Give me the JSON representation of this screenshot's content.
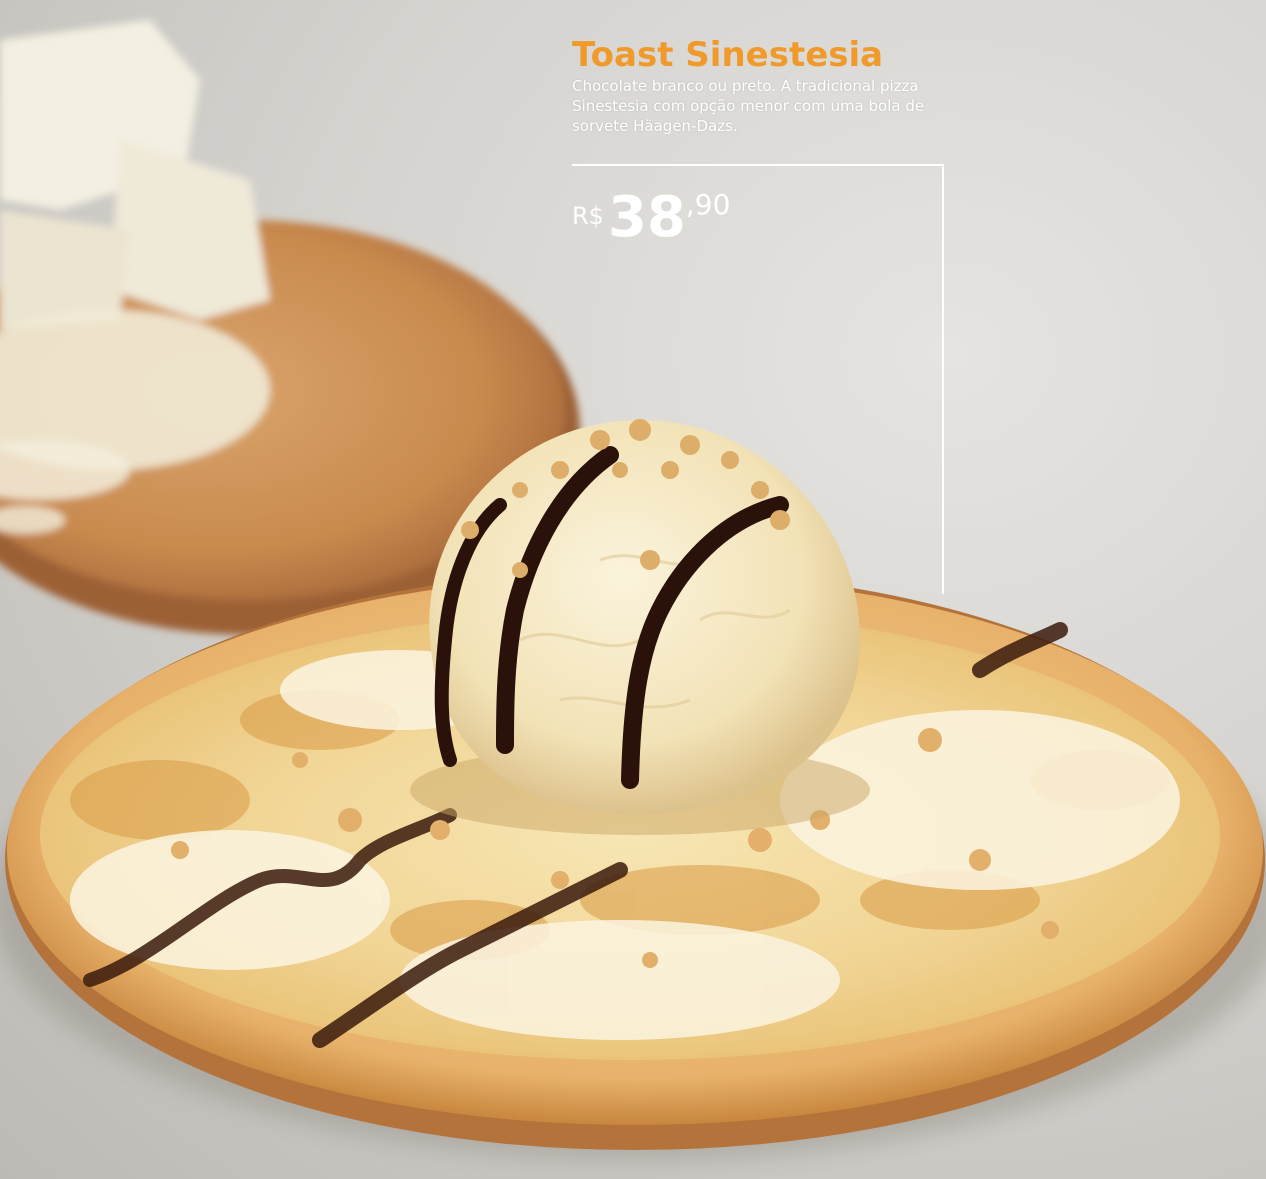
{
  "product": {
    "title": "Toast Sinestesia",
    "description": "Chocolate branco ou preto. A tradicional pizza Sinestesia com opção menor com uma bola de sorvete Häagen-Dazs.",
    "price": {
      "currency": "R$",
      "integer": "38",
      "cents": ",90"
    }
  },
  "colors": {
    "title": "#f19a2c",
    "text": "#ffffff",
    "background": "#d8d6d2"
  },
  "photo": {
    "subject": "dessert pizza with white chocolate, peanuts, chocolate syrup and a scoop of ice cream; wooden board with white chocolate in background"
  }
}
